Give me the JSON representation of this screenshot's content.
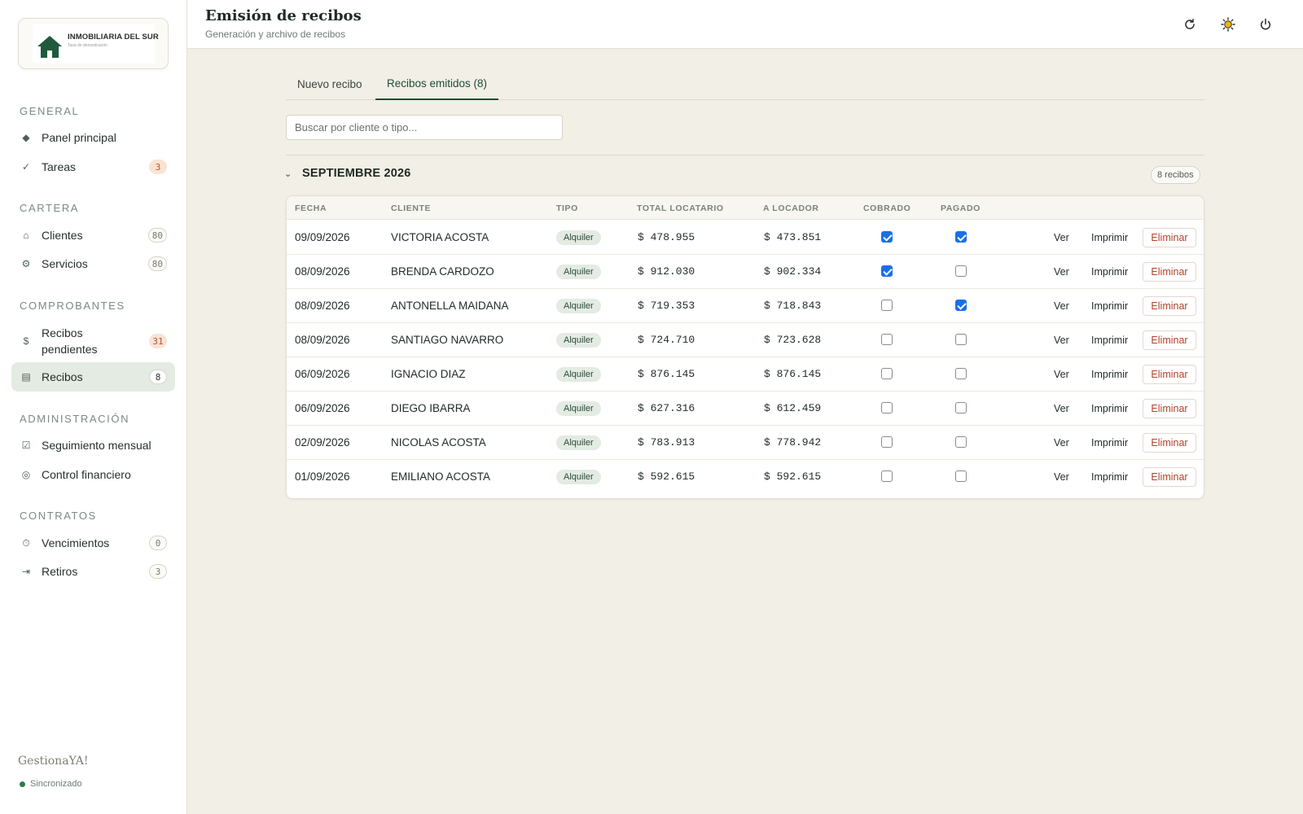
{
  "logo": {
    "name": "INMOBILIARIA DEL SUR",
    "subtitle": "Tasa de demostración"
  },
  "sidebar": {
    "sections": [
      {
        "title": "GENERAL",
        "items": [
          {
            "label": "Panel principal",
            "icon": "diamond-icon",
            "badge": ""
          },
          {
            "label": "Tareas",
            "icon": "check-icon",
            "badge": "3"
          }
        ]
      },
      {
        "title": "CARTERA",
        "items": [
          {
            "label": "Clientes",
            "icon": "home-icon",
            "badge": "80"
          },
          {
            "label": "Servicios",
            "icon": "gear-icon",
            "badge": "80"
          }
        ]
      },
      {
        "title": "COMPROBANTES",
        "items": [
          {
            "label": "Recibos pendientes",
            "icon": "dollar-icon",
            "badge": "31"
          },
          {
            "label": "Recibos",
            "icon": "receipt-icon",
            "badge": "8"
          }
        ]
      },
      {
        "title": "ADMINISTRACIÓN",
        "items": [
          {
            "label": "Seguimiento mensual",
            "icon": "checkbox-icon",
            "badge": ""
          },
          {
            "label": "Control financiero",
            "icon": "circle-icon",
            "badge": ""
          }
        ]
      },
      {
        "title": "CONTRATOS",
        "items": [
          {
            "label": "Vencimientos",
            "icon": "timer-icon",
            "badge": "0"
          },
          {
            "label": "Retiros",
            "icon": "exit-icon",
            "badge": "3"
          }
        ]
      }
    ],
    "brand": "GestionaYA!",
    "sync_status": "Sincronizado"
  },
  "header": {
    "title": "Emisión de recibos",
    "subtitle": "Generación y archivo de recibos"
  },
  "tabs": [
    {
      "label": "Nuevo recibo",
      "active": false
    },
    {
      "label": "Recibos emitidos (8)",
      "active": true
    }
  ],
  "search": {
    "placeholder": "Buscar por cliente o tipo...",
    "value": ""
  },
  "group": {
    "title": "SEPTIEMBRE 2026",
    "count": "8 recibos"
  },
  "table": {
    "columns": [
      "FECHA",
      "CLIENTE",
      "TIPO",
      "TOTAL LOCATARIO",
      "A LOCADOR",
      "COBRADO",
      "PAGADO"
    ],
    "actions": {
      "view": "Ver",
      "print": "Imprimir",
      "delete": "Eliminar"
    },
    "rows": [
      {
        "fecha": "09/09/2026",
        "cliente": "VICTORIA ACOSTA",
        "tipo": "Alquiler",
        "total": "$ 478.955",
        "locador": "$ 473.851",
        "cobrado": true,
        "pagado": true
      },
      {
        "fecha": "08/09/2026",
        "cliente": "BRENDA CARDOZO",
        "tipo": "Alquiler",
        "total": "$ 912.030",
        "locador": "$ 902.334",
        "cobrado": true,
        "pagado": false
      },
      {
        "fecha": "08/09/2026",
        "cliente": "ANTONELLA MAIDANA",
        "tipo": "Alquiler",
        "total": "$ 719.353",
        "locador": "$ 718.843",
        "cobrado": false,
        "pagado": true
      },
      {
        "fecha": "08/09/2026",
        "cliente": "SANTIAGO NAVARRO",
        "tipo": "Alquiler",
        "total": "$ 724.710",
        "locador": "$ 723.628",
        "cobrado": false,
        "pagado": false
      },
      {
        "fecha": "06/09/2026",
        "cliente": "IGNACIO DIAZ",
        "tipo": "Alquiler",
        "total": "$ 876.145",
        "locador": "$ 876.145",
        "cobrado": false,
        "pagado": false
      },
      {
        "fecha": "06/09/2026",
        "cliente": "DIEGO IBARRA",
        "tipo": "Alquiler",
        "total": "$ 627.316",
        "locador": "$ 612.459",
        "cobrado": false,
        "pagado": false
      },
      {
        "fecha": "02/09/2026",
        "cliente": "NICOLAS ACOSTA",
        "tipo": "Alquiler",
        "total": "$ 783.913",
        "locador": "$ 778.942",
        "cobrado": false,
        "pagado": false
      },
      {
        "fecha": "01/09/2026",
        "cliente": "EMILIANO ACOSTA",
        "tipo": "Alquiler",
        "total": "$ 592.615",
        "locador": "$ 592.615",
        "cobrado": false,
        "pagado": false
      }
    ]
  },
  "colors": {
    "accent": "#1e4d37",
    "active_bg": "#e3ebe3",
    "danger": "#b0432b",
    "checkbox": "#1a6fe8",
    "sun": "#e8b80a"
  }
}
